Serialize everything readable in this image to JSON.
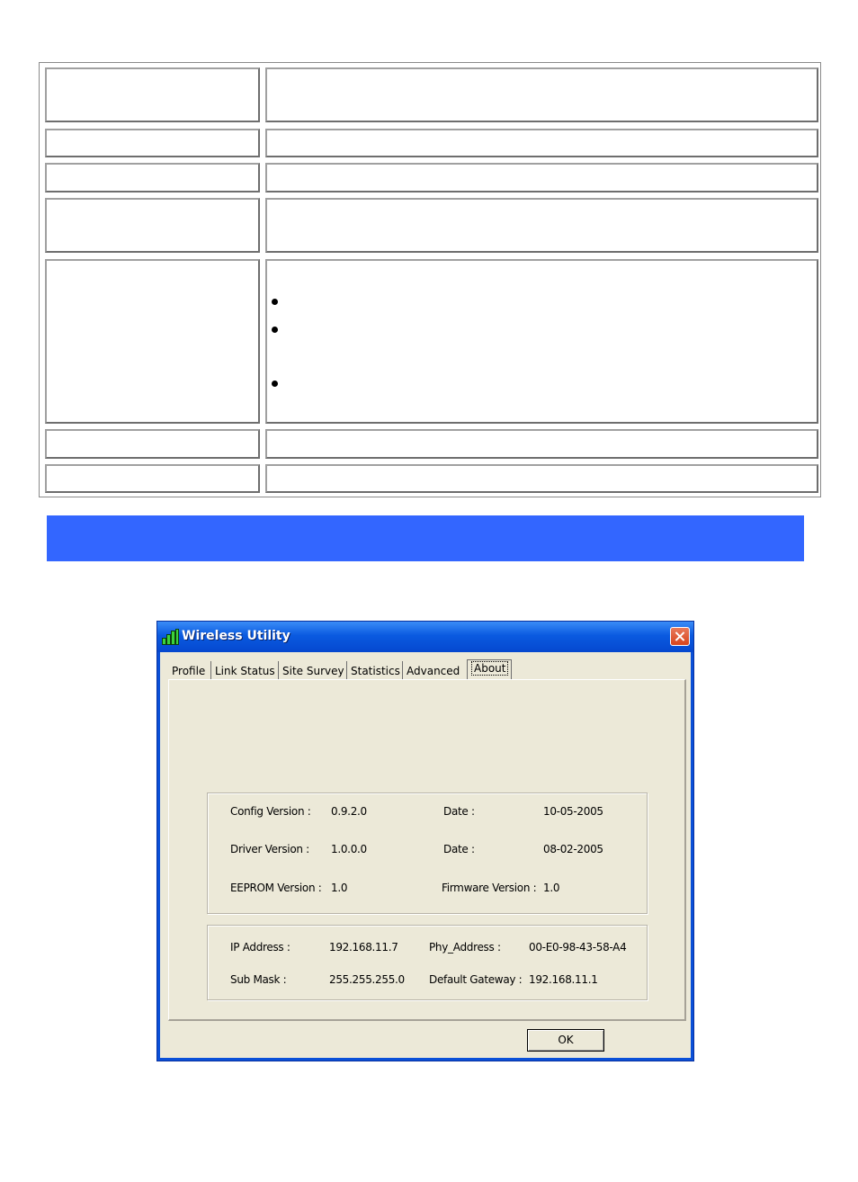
{
  "dialog": {
    "title": "Wireless Utility",
    "tabs": [
      "Profile",
      "Link Status",
      "Site Survey",
      "Statistics",
      "Advanced",
      "About"
    ],
    "active_tab": "About",
    "version_info": {
      "config_version_label": "Config Version :",
      "config_version_value": "0.9.2.0",
      "config_date_label": "Date :",
      "config_date_value": "10-05-2005",
      "driver_version_label": "Driver Version :",
      "driver_version_value": "1.0.0.0",
      "driver_date_label": "Date :",
      "driver_date_value": "08-02-2005",
      "eeprom_version_label": "EEPROM Version :",
      "eeprom_version_value": "1.0",
      "firmware_version_label": "Firmware Version :",
      "firmware_version_value": "1.0"
    },
    "network_info": {
      "ip_address_label": "IP Address :",
      "ip_address_value": "192.168.11.7",
      "phy_address_label": "Phy_Address :",
      "phy_address_value": "00-E0-98-43-58-A4",
      "sub_mask_label": "Sub Mask :",
      "sub_mask_value": "255.255.255.0",
      "default_gateway_label": "Default Gateway :",
      "default_gateway_value": "192.168.11.1"
    },
    "ok_label": "OK"
  },
  "colors": {
    "banner": "#3366ff",
    "titlebar": "#0a5ae0",
    "dialog_face": "#ece9d8",
    "close_button": "#d8441c"
  }
}
